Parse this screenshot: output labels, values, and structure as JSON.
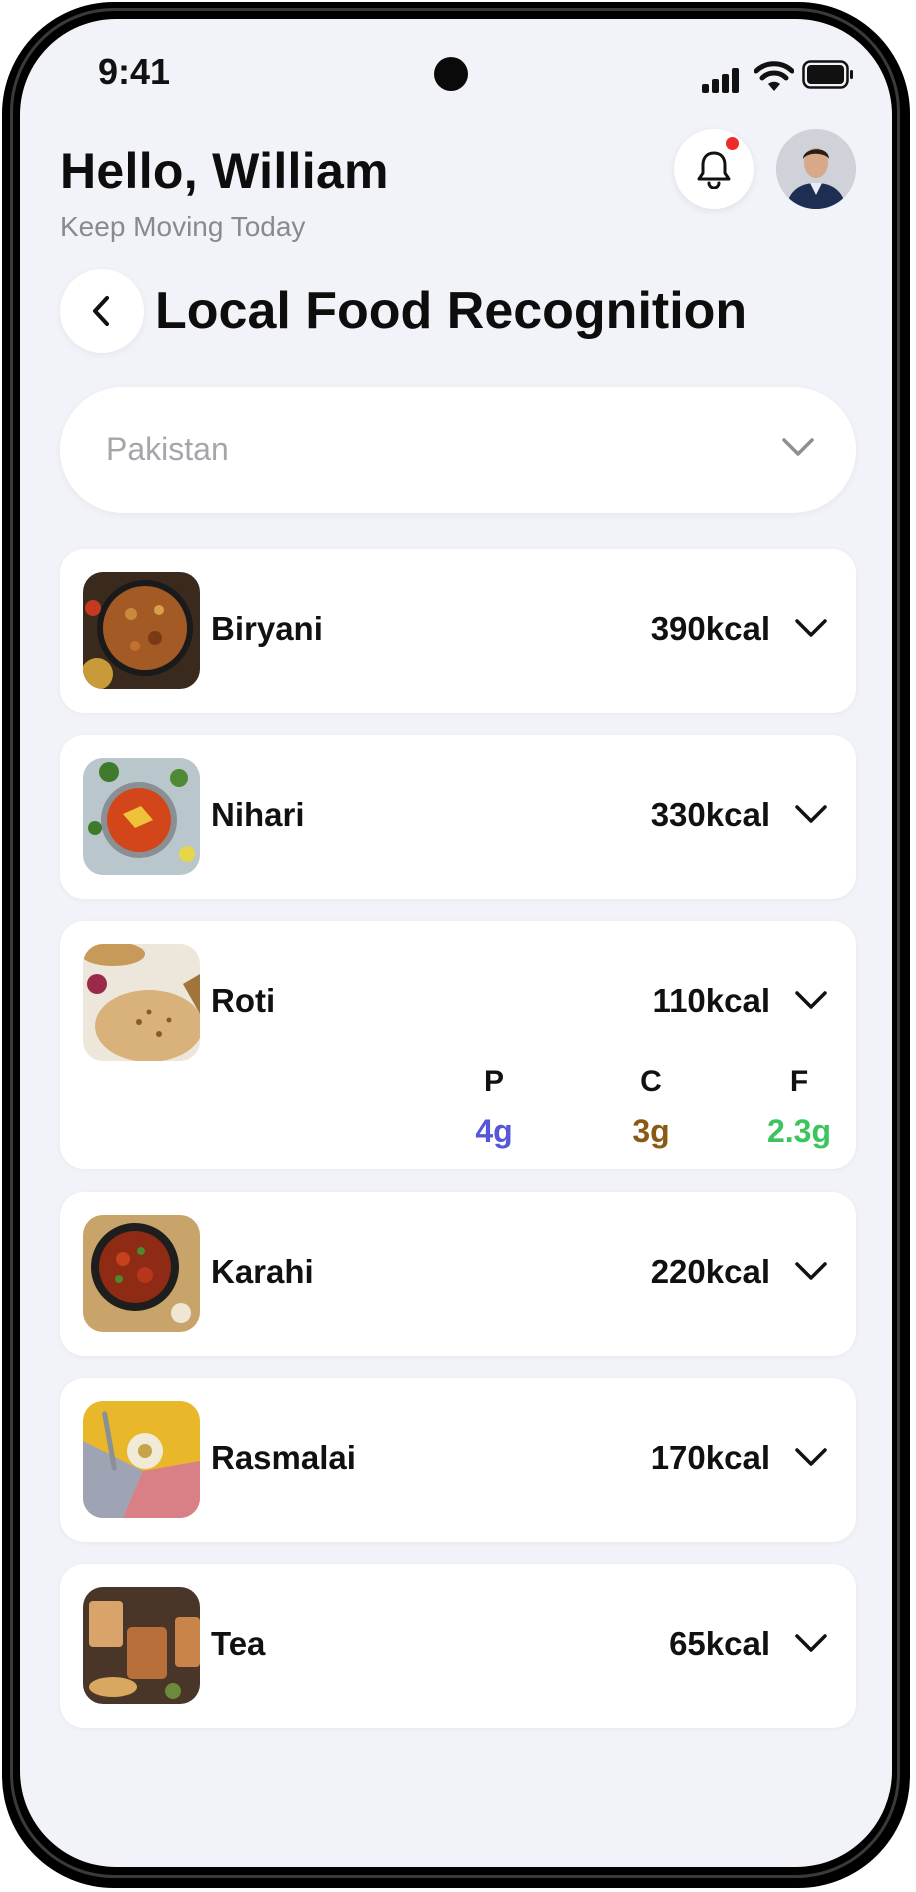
{
  "status_bar": {
    "time": "9:41"
  },
  "header": {
    "greeting": "Hello, William",
    "subtitle": "Keep Moving Today"
  },
  "page": {
    "title": "Local Food Recognition"
  },
  "country_select": {
    "value": "Pakistan"
  },
  "foods": [
    {
      "name": "Biryani",
      "kcal": "390kcal"
    },
    {
      "name": "Nihari",
      "kcal": "330kcal"
    },
    {
      "name": "Roti",
      "kcal": "110kcal",
      "macros": [
        {
          "label": "P",
          "value": "4g",
          "color": "#5557d8"
        },
        {
          "label": "C",
          "value": "3g",
          "color": "#8a5a14"
        },
        {
          "label": "F",
          "value": "2.3g",
          "color": "#3dc45e"
        }
      ]
    },
    {
      "name": "Karahi",
      "kcal": "220kcal"
    },
    {
      "name": "Rasmalai",
      "kcal": "170kcal"
    },
    {
      "name": "Tea",
      "kcal": "65kcal"
    }
  ],
  "colors": {
    "background": "#f2f3f8",
    "notification_dot": "#ef2a2a",
    "protein": "#5557d8",
    "carbs": "#8a5a14",
    "fat": "#3dc45e"
  },
  "icons": [
    "bell-icon",
    "avatar",
    "back-arrow-icon",
    "chevron-down-icon",
    "signal-icon",
    "wifi-icon",
    "battery-icon"
  ]
}
